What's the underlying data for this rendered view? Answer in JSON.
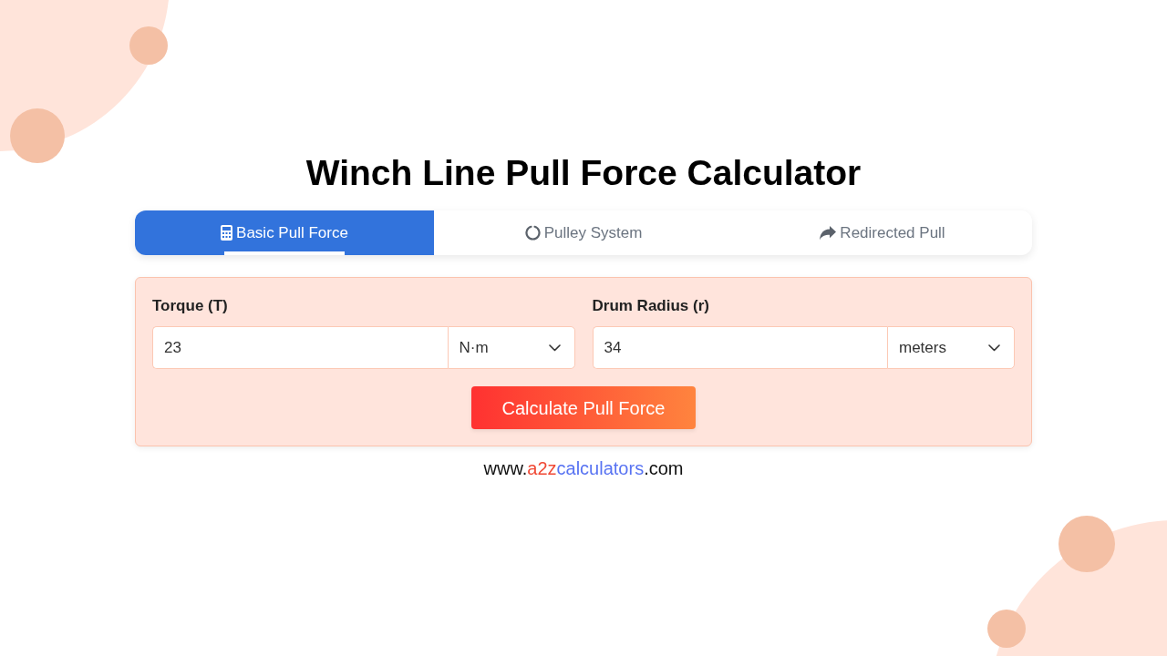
{
  "title": "Winch Line Pull Force Calculator",
  "tabs": [
    {
      "label": "Basic Pull Force",
      "selected": true
    },
    {
      "label": "Pulley System",
      "selected": false
    },
    {
      "label": "Redirected Pull",
      "selected": false
    }
  ],
  "fields": [
    {
      "label": "Torque (T)",
      "value": "23",
      "unit": "N·m"
    },
    {
      "label": "Drum Radius (r)",
      "value": "34",
      "unit": "meters"
    }
  ],
  "calculate_button": "Calculate Pull Force",
  "site_url": [
    {
      "text": "www.",
      "color": "#111111"
    },
    {
      "text": "a2z",
      "color": "#f04a36"
    },
    {
      "text": "calculators",
      "color": "#5873f2"
    },
    {
      "text": ".com",
      "color": "#111111"
    }
  ]
}
